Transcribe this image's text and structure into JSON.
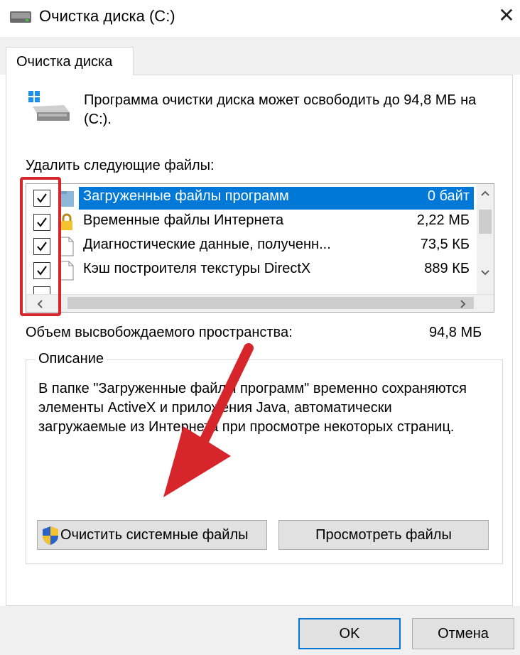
{
  "window": {
    "title": "Очистка диска  (C:)",
    "close_glyph": "✕"
  },
  "tabs": [
    {
      "label": "Очистка диска"
    }
  ],
  "summary": {
    "text": "Программа очистки диска может освободить до 94,8 МБ на  (C:)."
  },
  "files_label": "Удалить следующие файлы:",
  "files": [
    {
      "name": "Загруженные файлы программ",
      "size": "0 байт",
      "checked": true,
      "selected": true,
      "icon": "folder-icon"
    },
    {
      "name": "Временные файлы Интернета",
      "size": "2,22 МБ",
      "checked": true,
      "selected": false,
      "icon": "lock-icon"
    },
    {
      "name": "Диагностические данные, полученн...",
      "size": "73,5 КБ",
      "checked": true,
      "selected": false,
      "icon": "file-icon"
    },
    {
      "name": "Кэш построителя текстуры DirectX",
      "size": "889 КБ",
      "checked": true,
      "selected": false,
      "icon": "file-icon"
    }
  ],
  "space": {
    "label": "Объем высвобождаемого пространства:",
    "value": "94,8 МБ"
  },
  "description": {
    "label": "Описание",
    "text": "В папке \"Загруженные файлы программ\" временно сохраняются элементы ActiveX и приложения Java, автоматически загружаемые из Интернета при просмотре некоторых страниц."
  },
  "buttons": {
    "clean_system": "Очистить системные файлы",
    "view_files": "Просмотреть файлы",
    "ok": "OK",
    "cancel": "Отмена"
  },
  "colors": {
    "selection": "#0078d7",
    "annotation": "#d6252b"
  }
}
